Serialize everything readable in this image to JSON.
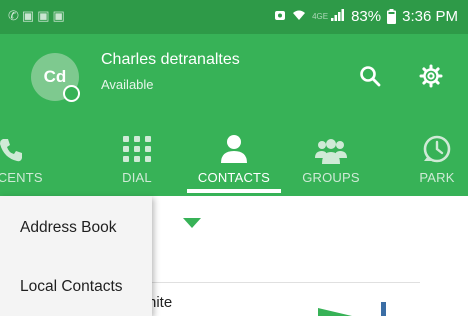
{
  "status_bar": {
    "network_type": "4GE",
    "battery": "83%",
    "time": "3:36 PM"
  },
  "user": {
    "initials": "Cd",
    "name": "Charles detranaltes",
    "status": "Available"
  },
  "tabs": [
    {
      "label": "RECENTS",
      "icon": "phone-icon",
      "active": false
    },
    {
      "label": "DIAL",
      "icon": "dialpad-icon",
      "active": false
    },
    {
      "label": "CONTACTS",
      "icon": "person-icon",
      "active": true
    },
    {
      "label": "GROUPS",
      "icon": "groups-icon",
      "active": false
    },
    {
      "label": "PARK",
      "icon": "park-icon",
      "active": false
    }
  ],
  "menu": {
    "items": [
      "Address Book",
      "Local Contacts"
    ]
  },
  "contact_list": {
    "partial_name": "hite"
  },
  "colors": {
    "status_bar": "#2e9a48",
    "header": "#37b257",
    "menu_background": "#f4f4f4"
  }
}
